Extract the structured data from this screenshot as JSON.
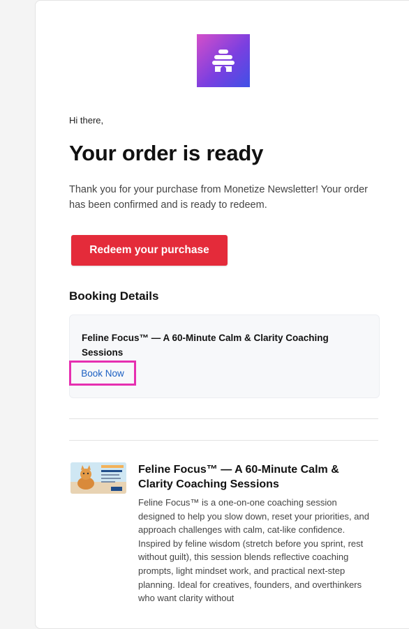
{
  "email": {
    "greeting": "Hi there,",
    "title": "Your order is ready",
    "intro": "Thank you for your purchase from Monetize Newsletter! Your order has been confirmed and is ready to redeem.",
    "redeem_button": "Redeem your purchase"
  },
  "booking": {
    "section_title": "Booking Details",
    "item_name": "Feline Focus™ — A 60-Minute Calm & Clarity Coaching Sessions",
    "book_now": "Book Now"
  },
  "product": {
    "title": "Feline Focus™ — A 60-Minute Calm & Clarity Coaching Sessions",
    "description": "Feline Focus™ is a one-on-one coaching session designed to help you slow down, reset your priorities, and approach challenges with calm, cat-like confidence. Inspired by feline wisdom (stretch before you sprint, rest without guilt), this session blends reflective coaching prompts, light mindset work, and practical next-step planning. Ideal for creatives, founders, and overthinkers who want clarity without"
  },
  "icons": {
    "logo": "beehive-logo-icon",
    "thumbnail": "product-thumbnail-image"
  },
  "colors": {
    "accent_button": "#e42b3a",
    "link": "#1a5fc2",
    "highlight_border": "#e62fb0",
    "logo_gradient_start": "#d44fc9",
    "logo_gradient_end": "#3f51e6"
  }
}
